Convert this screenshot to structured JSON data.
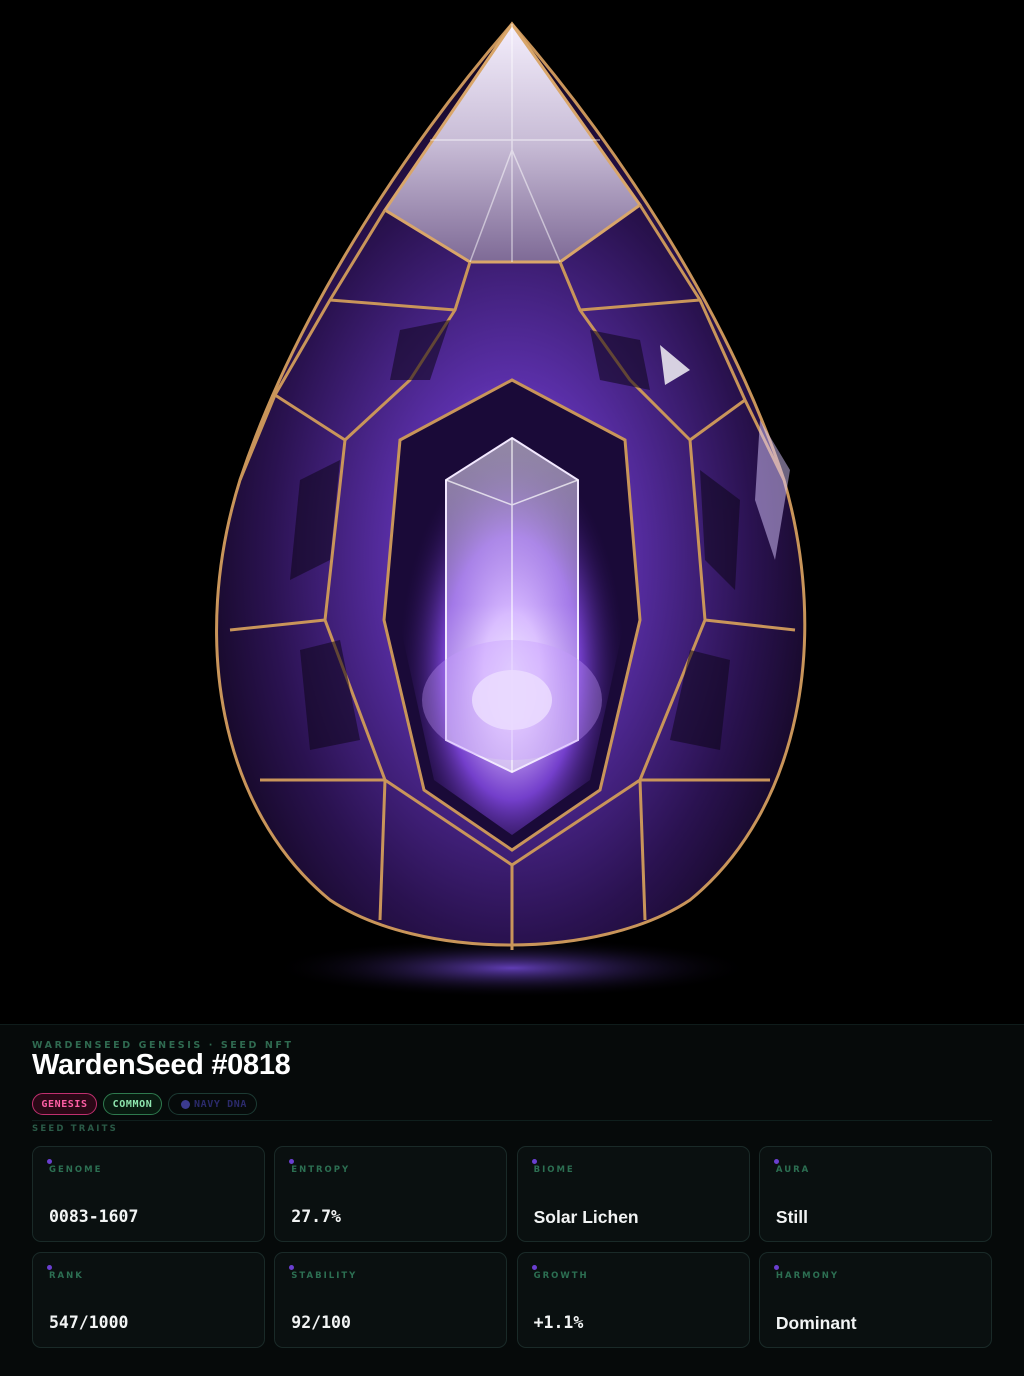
{
  "hero": {
    "image_subject": "gem-seed-artwork"
  },
  "header": {
    "eyebrow": "WARDENSEED GENESIS · SEED NFT",
    "title": "WardenSeed #0818"
  },
  "badges": {
    "genesis": "GENESIS",
    "common": "COMMON",
    "dna": "NAVY DNA"
  },
  "traits": {
    "section_label": "SEED TRAITS",
    "items": [
      {
        "label": "GENOME",
        "value": "0083-1607"
      },
      {
        "label": "ENTROPY",
        "value": "27.7%"
      },
      {
        "label": "BIOME",
        "value": "Solar Lichen"
      },
      {
        "label": "AURA",
        "value": "Still"
      },
      {
        "label": "RANK",
        "value": "547/1000"
      },
      {
        "label": "STABILITY",
        "value": "92/100"
      },
      {
        "label": "GROWTH",
        "value": "+1.1%"
      },
      {
        "label": "HARMONY",
        "value": "Dominant"
      }
    ]
  },
  "colors": {
    "background": "#000000",
    "panel": "#060a0a",
    "accent_purple": "#7a4fe0",
    "gold": "#c9955a",
    "genesis_pink": "#ff5fa6",
    "common_green": "#8ee5ae",
    "label_green": "#2c6f52"
  }
}
